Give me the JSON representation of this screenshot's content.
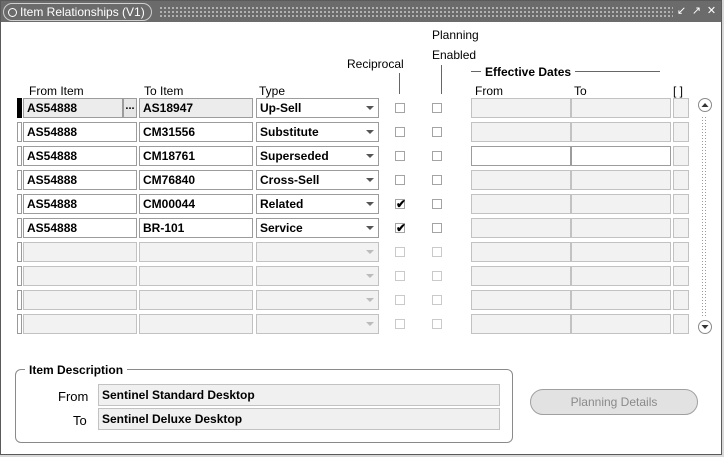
{
  "window": {
    "title": "Item Relationships (V1)"
  },
  "columns": {
    "from_item": "From Item",
    "to_item": "To Item",
    "type": "Type",
    "reciprocal": "Reciprocal",
    "planning_1": "Planning",
    "planning_2": "Enabled",
    "effective_dates": "Effective Dates",
    "from": "From",
    "to": "To",
    "flex": "[ ]"
  },
  "rows": [
    {
      "from_item": "AS54888",
      "to_item": "AS18947",
      "type": "Up-Sell",
      "reciprocal": "",
      "planning": "",
      "from_date": "",
      "to_date": ""
    },
    {
      "from_item": "AS54888",
      "to_item": "CM31556",
      "type": "Substitute",
      "reciprocal": "",
      "planning": "",
      "from_date": "",
      "to_date": ""
    },
    {
      "from_item": "AS54888",
      "to_item": "CM18761",
      "type": "Superseded",
      "reciprocal": "",
      "planning": "",
      "from_date": "",
      "to_date": ""
    },
    {
      "from_item": "AS54888",
      "to_item": "CM76840",
      "type": "Cross-Sell",
      "reciprocal": "",
      "planning": "",
      "from_date": "",
      "to_date": ""
    },
    {
      "from_item": "AS54888",
      "to_item": "CM00044",
      "type": "Related",
      "reciprocal": "✔",
      "planning": "",
      "from_date": "",
      "to_date": ""
    },
    {
      "from_item": "AS54888",
      "to_item": "BR-101",
      "type": "Service",
      "reciprocal": "✔",
      "planning": "",
      "from_date": "",
      "to_date": ""
    },
    {
      "from_item": "",
      "to_item": "",
      "type": "",
      "reciprocal": "",
      "planning": "",
      "from_date": "",
      "to_date": ""
    },
    {
      "from_item": "",
      "to_item": "",
      "type": "",
      "reciprocal": "",
      "planning": "",
      "from_date": "",
      "to_date": ""
    },
    {
      "from_item": "",
      "to_item": "",
      "type": "",
      "reciprocal": "",
      "planning": "",
      "from_date": "",
      "to_date": ""
    },
    {
      "from_item": "",
      "to_item": "",
      "type": "",
      "reciprocal": "",
      "planning": "",
      "from_date": "",
      "to_date": ""
    }
  ],
  "lov_button": "...",
  "item_description": {
    "label": "Item Description",
    "from_label": "From",
    "from_value": "Sentinel Standard Desktop",
    "to_label": "To",
    "to_value": "Sentinel Deluxe Desktop"
  },
  "planning_details_button": "Planning Details",
  "icons": {
    "minimize": "minimize-icon",
    "maximize": "maximize-icon",
    "close": "close-icon"
  }
}
